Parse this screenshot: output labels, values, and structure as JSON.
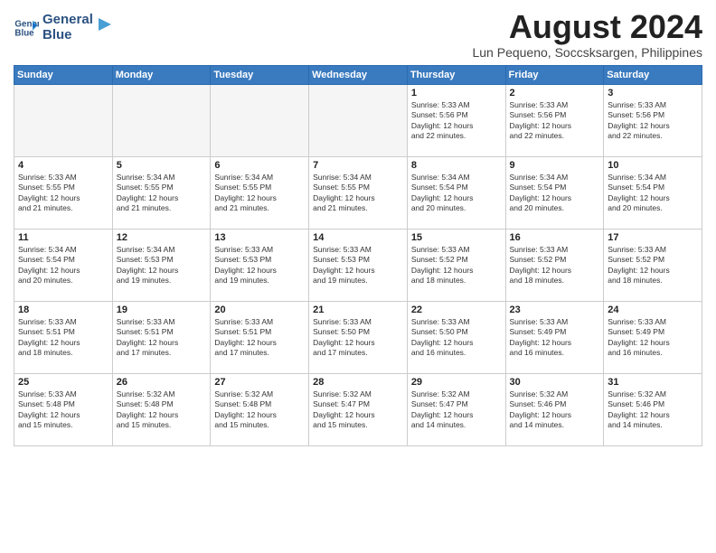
{
  "header": {
    "logo_line1": "General",
    "logo_line2": "Blue",
    "month_year": "August 2024",
    "location": "Lun Pequeno, Soccsksargen, Philippines"
  },
  "weekdays": [
    "Sunday",
    "Monday",
    "Tuesday",
    "Wednesday",
    "Thursday",
    "Friday",
    "Saturday"
  ],
  "weeks": [
    [
      {
        "day": "",
        "info": "",
        "empty": true
      },
      {
        "day": "",
        "info": "",
        "empty": true
      },
      {
        "day": "",
        "info": "",
        "empty": true
      },
      {
        "day": "",
        "info": "",
        "empty": true
      },
      {
        "day": "1",
        "info": "Sunrise: 5:33 AM\nSunset: 5:56 PM\nDaylight: 12 hours\nand 22 minutes.",
        "empty": false
      },
      {
        "day": "2",
        "info": "Sunrise: 5:33 AM\nSunset: 5:56 PM\nDaylight: 12 hours\nand 22 minutes.",
        "empty": false
      },
      {
        "day": "3",
        "info": "Sunrise: 5:33 AM\nSunset: 5:56 PM\nDaylight: 12 hours\nand 22 minutes.",
        "empty": false
      }
    ],
    [
      {
        "day": "4",
        "info": "Sunrise: 5:33 AM\nSunset: 5:55 PM\nDaylight: 12 hours\nand 21 minutes.",
        "empty": false
      },
      {
        "day": "5",
        "info": "Sunrise: 5:34 AM\nSunset: 5:55 PM\nDaylight: 12 hours\nand 21 minutes.",
        "empty": false
      },
      {
        "day": "6",
        "info": "Sunrise: 5:34 AM\nSunset: 5:55 PM\nDaylight: 12 hours\nand 21 minutes.",
        "empty": false
      },
      {
        "day": "7",
        "info": "Sunrise: 5:34 AM\nSunset: 5:55 PM\nDaylight: 12 hours\nand 21 minutes.",
        "empty": false
      },
      {
        "day": "8",
        "info": "Sunrise: 5:34 AM\nSunset: 5:54 PM\nDaylight: 12 hours\nand 20 minutes.",
        "empty": false
      },
      {
        "day": "9",
        "info": "Sunrise: 5:34 AM\nSunset: 5:54 PM\nDaylight: 12 hours\nand 20 minutes.",
        "empty": false
      },
      {
        "day": "10",
        "info": "Sunrise: 5:34 AM\nSunset: 5:54 PM\nDaylight: 12 hours\nand 20 minutes.",
        "empty": false
      }
    ],
    [
      {
        "day": "11",
        "info": "Sunrise: 5:34 AM\nSunset: 5:54 PM\nDaylight: 12 hours\nand 20 minutes.",
        "empty": false
      },
      {
        "day": "12",
        "info": "Sunrise: 5:34 AM\nSunset: 5:53 PM\nDaylight: 12 hours\nand 19 minutes.",
        "empty": false
      },
      {
        "day": "13",
        "info": "Sunrise: 5:33 AM\nSunset: 5:53 PM\nDaylight: 12 hours\nand 19 minutes.",
        "empty": false
      },
      {
        "day": "14",
        "info": "Sunrise: 5:33 AM\nSunset: 5:53 PM\nDaylight: 12 hours\nand 19 minutes.",
        "empty": false
      },
      {
        "day": "15",
        "info": "Sunrise: 5:33 AM\nSunset: 5:52 PM\nDaylight: 12 hours\nand 18 minutes.",
        "empty": false
      },
      {
        "day": "16",
        "info": "Sunrise: 5:33 AM\nSunset: 5:52 PM\nDaylight: 12 hours\nand 18 minutes.",
        "empty": false
      },
      {
        "day": "17",
        "info": "Sunrise: 5:33 AM\nSunset: 5:52 PM\nDaylight: 12 hours\nand 18 minutes.",
        "empty": false
      }
    ],
    [
      {
        "day": "18",
        "info": "Sunrise: 5:33 AM\nSunset: 5:51 PM\nDaylight: 12 hours\nand 18 minutes.",
        "empty": false
      },
      {
        "day": "19",
        "info": "Sunrise: 5:33 AM\nSunset: 5:51 PM\nDaylight: 12 hours\nand 17 minutes.",
        "empty": false
      },
      {
        "day": "20",
        "info": "Sunrise: 5:33 AM\nSunset: 5:51 PM\nDaylight: 12 hours\nand 17 minutes.",
        "empty": false
      },
      {
        "day": "21",
        "info": "Sunrise: 5:33 AM\nSunset: 5:50 PM\nDaylight: 12 hours\nand 17 minutes.",
        "empty": false
      },
      {
        "day": "22",
        "info": "Sunrise: 5:33 AM\nSunset: 5:50 PM\nDaylight: 12 hours\nand 16 minutes.",
        "empty": false
      },
      {
        "day": "23",
        "info": "Sunrise: 5:33 AM\nSunset: 5:49 PM\nDaylight: 12 hours\nand 16 minutes.",
        "empty": false
      },
      {
        "day": "24",
        "info": "Sunrise: 5:33 AM\nSunset: 5:49 PM\nDaylight: 12 hours\nand 16 minutes.",
        "empty": false
      }
    ],
    [
      {
        "day": "25",
        "info": "Sunrise: 5:33 AM\nSunset: 5:48 PM\nDaylight: 12 hours\nand 15 minutes.",
        "empty": false
      },
      {
        "day": "26",
        "info": "Sunrise: 5:32 AM\nSunset: 5:48 PM\nDaylight: 12 hours\nand 15 minutes.",
        "empty": false
      },
      {
        "day": "27",
        "info": "Sunrise: 5:32 AM\nSunset: 5:48 PM\nDaylight: 12 hours\nand 15 minutes.",
        "empty": false
      },
      {
        "day": "28",
        "info": "Sunrise: 5:32 AM\nSunset: 5:47 PM\nDaylight: 12 hours\nand 15 minutes.",
        "empty": false
      },
      {
        "day": "29",
        "info": "Sunrise: 5:32 AM\nSunset: 5:47 PM\nDaylight: 12 hours\nand 14 minutes.",
        "empty": false
      },
      {
        "day": "30",
        "info": "Sunrise: 5:32 AM\nSunset: 5:46 PM\nDaylight: 12 hours\nand 14 minutes.",
        "empty": false
      },
      {
        "day": "31",
        "info": "Sunrise: 5:32 AM\nSunset: 5:46 PM\nDaylight: 12 hours\nand 14 minutes.",
        "empty": false
      }
    ]
  ]
}
